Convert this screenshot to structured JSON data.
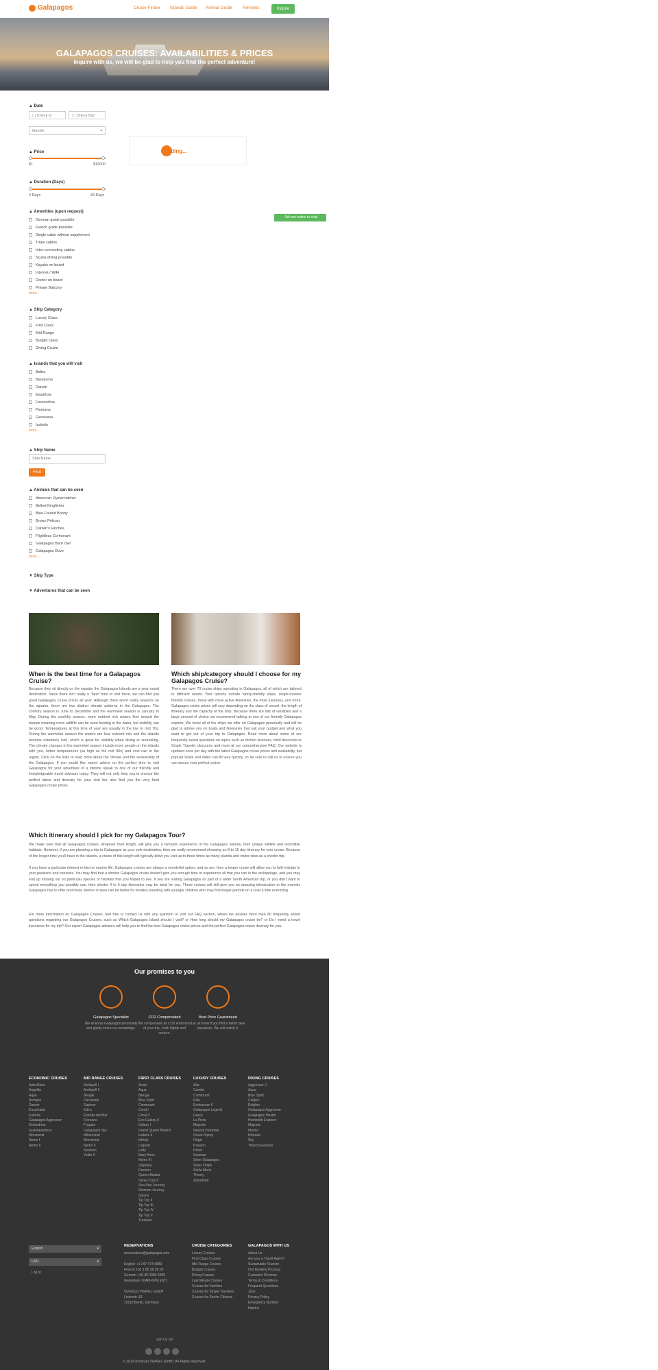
{
  "nav": {
    "logo": "Galapagos",
    "links": [
      "Cruise Finder",
      "Islands Guide",
      "Animal Guide",
      "Reviews"
    ],
    "button": "Inquire"
  },
  "hero": {
    "title": "GALAPAGOS CRUISES: AVAILABILITIES & PRICES",
    "subtitle": "Inquire with us, we will be glad to help you find the perfect adventure!"
  },
  "filters": {
    "date": {
      "title": "Date",
      "checkin": "Check In",
      "checkout": "Check Out",
      "guests": "Guests"
    },
    "price": {
      "title": "Price",
      "min": "$1",
      "max": "$15000"
    },
    "duration": {
      "title": "Duration (Days)",
      "min": "2 Days",
      "max": "30 Days"
    },
    "amenities": {
      "title": "Amenities (upon request)",
      "items": [
        "German guide possible",
        "French guide possible",
        "Single cabin without supplement",
        "Triple cabins",
        "Inter-connecting cabins",
        "Scuba diving possible",
        "Kayaks on board",
        "Internet / WiFi",
        "Doctor on board",
        "Private Balcony"
      ],
      "more": "more..."
    },
    "category": {
      "title": "Ship Category",
      "items": [
        "Luxury Class",
        "First Class",
        "Mid-Range",
        "Budget Class",
        "Diving Cruise"
      ]
    },
    "islands": {
      "title": "Islands that you will visit",
      "items": [
        "Baltra",
        "Bartolome",
        "Darwin",
        "Española",
        "Fernandina",
        "Floreana",
        "Genovesa",
        "Isabela"
      ],
      "more": "more..."
    },
    "ship": {
      "title": "Ship Name",
      "placeholder": "Ship Name",
      "button": "Find"
    },
    "animals": {
      "title": "Animals that can be seen",
      "items": [
        "American Oystercatcher",
        "Belted Kingfisher",
        "Blue Footed Booby",
        "Brown Pelican",
        "Darwin's Finches",
        "Flightless Cormorant",
        "Galapagos Barn Owl",
        "Galapagos Dove"
      ],
      "more": "more..."
    },
    "shiptype": {
      "title": "Ship Type"
    },
    "adventures": {
      "title": "Adventures that can be seen"
    }
  },
  "loading": "Loading...",
  "chat": "We are online to chat",
  "articles": [
    {
      "title": "When is the best time for a Galapagos Cruise?",
      "text": "Because they sit directly on the equator the Galapagos Islands are a year-round destination. Since there isn't really a \"best\" time to visit there, we can find you good Galapagos cruise prices all year. Although there aren't really seasons on the equator, there are two distinct climate patterns in the Galapagos. The cool/dry season is June to December and the warm/wet season is January to May. During the cool/dry season, more nutrient rich waters flow toward the islands meaning more wildlife can be seen feeding in the water, but visibility can be good. Temperatures at this time of year are usually in the low to mid 70s. During the warm/wet season the waters are less nutrient rich and the islands become extremely lush, which is great for visibility when diving or snorkeling. The climate changes in the warm/wet season include more people on the islands with you, hotter temperatures (as high as the mid 80s) and cool rain in the region. Click on the links to read more about the climate and the seasonality of the Galapagos. If you would like expert advice on the perfect time to visit Galapagos for your adventure of a lifetime speak to one of our friendly and knowledgeable travel advisors today. They will not only help you to choose the perfect dates and itinerary for your visit but also find you the very best Galapagos cruise prices."
    },
    {
      "title": "Which ship/category should I choose for my Galapagos Cruise?",
      "text": "There are over 70 cruise ships operating in Galapagos, all of which are tailored to different needs. Your options include family-friendly ships, single-traveler friendly cruises, those with more active itineraries, the most luxurious, and more. Galapagos cruise prices will vary depending on the class of vessel, the length of itinerary and the capacity of the ship. Because there are lots of variables and a large amount of choice we recommend talking to one of our friendly Galapagos experts. We know all of the ships we offer on Galapagos personally and will be glad to advise you on boats and itineraries that suit your budget and what you want to get out of your trip to Galapagos. Read more about some of our frequently asked questions on topics such as motion sickness, child discounts or Single Traveler discounts and more at our comprehensive FAQ. Our website is updated once per day with the latest Galapagos cruise prices and availability, but popular boats and dates can fill very quickly, so be sure to call us to ensure you can secure your perfect cruise."
    }
  ],
  "itinerary": {
    "title": "Which itinerary should I pick for my Galapagos Tour?",
    "p1": "We make sure that all Galapagos cruises, whatever their length, will give you a fantastic experience of the Galapagos Islands, their unique wildlife and incredible habitats. However, if you are planning a trip to Galapagos as your sole destination, then we really recommend choosing an 8 to 15 day itinerary for your cruise. Because of the longer time you'll have in the islands, a cruise of this length will typically allow you visit up to three times as many islands and visitor sites as a shorter trip.",
    "p2": "If you have a particular interest in bird or marine life, Galapagos cruises are always a wonderful option, and so are, then a longer cruise will allow you to fully indulge in your passions and interests. You may find that a shorter Galapagos cruise doesn't give you enough time to experience all that you can in the archipelago, and you may end up missing out on particular species or habitats that you hoped to see. If you are visiting Galapagos as part of a wider South American trip, or you don't want to spend everything you possibly can, then shorter 4 to 6 day itineraries may be ideal for you. These cruises will still give you an amazing introduction to the marvels Galapagos has to offer and these shorter cruises can be better for families traveling with younger children who may find longer periods on a boat a little restricting.",
    "p3": "For more information on Galapagos Cruises, feel free to contact us with any question or visit our FAQ section, where we answer more than 80 frequently asked questions regarding our Galapagos Cruises, such as Which Galapagos Island should I visit? or How long should my Galapagos cruise be? or Do I need a travel insurance for my trip? Our expert Galapagos advisors will help you to find the best Galapagos cruise prices and the perfect Galapagos cruise itinerary for you."
  },
  "promises": {
    "title": "Our promises to you",
    "items": [
      {
        "t": "Galapagos Specialist",
        "d": "We all know Galapagos personally and gladly share our knowledge."
      },
      {
        "t": "CO2 Compensated",
        "d": "We compensate all CO2 emissions of your trip - both flights and cruises."
      },
      {
        "t": "Best Price Guaranteed",
        "d": "Let us know if you find a better deal anywhere. We will match it."
      }
    ]
  },
  "columns": [
    {
      "h": "ECONOMIC CRUISES",
      "items": [
        "Aida Maria",
        "Angelito",
        "Aqua",
        "Archipel",
        "Darwin",
        "Encantada",
        "Estrella",
        "Galapagos Aggressor",
        "Golondrina",
        "Guantanamera",
        "Monserrat",
        "Nemo I",
        "Nemo II"
      ]
    },
    {
      "h": "MID RANGE CRUISES",
      "items": [
        "Archipell I",
        "Archipell II",
        "Beagle",
        "Cachalote",
        "Daphne",
        "Eden",
        "Estrella del Mar",
        "Floreana",
        "Fragata",
        "Galapagos Sky",
        "Millennium",
        "Monserrat",
        "Nemo II",
        "Seaman",
        "Yolita II"
      ]
    },
    {
      "h": "FIRST CLASS CRUISES",
      "items": [
        "Anahi",
        "Aqua",
        "Beluga",
        "Blue Spirit",
        "Cormorant",
        "Coral I",
        "Coral II",
        "Eco Galaxy II",
        "Galaxy I",
        "Grand Queen Beatriz",
        "Isabela II",
        "Infinity",
        "Legend",
        "Letty",
        "Mary Anne",
        "Nemo III",
        "Odyssey",
        "Passion",
        "Queen Beatriz",
        "Santa Cruz II",
        "Sea Star Journey",
        "Seaman Journey",
        "Solaris",
        "Tip Top II",
        "Tip Top III",
        "Tip Top IV",
        "Tip Top V",
        "Treasure"
      ]
    },
    {
      "h": "LUXURY CRUISES",
      "items": [
        "Alia",
        "Camila",
        "Cormorant",
        "Elite",
        "Endeavour II",
        "Galapagos Legend",
        "Grace",
        "La Pinta",
        "Majestic",
        "Natural Paradise",
        "Ocean Spray",
        "Origin",
        "Passion",
        "Petrel",
        "Seaman",
        "Silver Galapagos",
        "Silver Origin",
        "Stella Maris",
        "Theory",
        "Xploration"
      ]
    },
    {
      "h": "DIVING CRUISES",
      "items": [
        "Aggressor II",
        "Aqua",
        "Blue Spirit",
        "Calipso",
        "Dolphin",
        "Galapagos Aggressor",
        "Galapagos Master",
        "Humboldt Explorer",
        "Majestic",
        "Master",
        "Nortada",
        "Sky",
        "Tiburon Explorer"
      ]
    }
  ],
  "footer": {
    "lang": "English",
    "currency": "USD",
    "login": "Log In",
    "reservations": {
      "h": "RESERVATIONS",
      "lines": [
        "reservations@galapagos.com",
        "",
        "English +1 347 474 6883",
        "French +33 1 86 26 26 05",
        "German +49 30 3080 9999",
        "(weekdays 10AM-6PM EST)",
        "",
        "Viventura TRAVEL GmbH",
        "Linienstr. 81",
        "10119 Berlin, Germany"
      ]
    },
    "categories": {
      "h": "CRUISE CATEGORIES",
      "lines": [
        "Luxury Cruises",
        "First Class Cruises",
        "Mid Range Cruises",
        "Budget Cruises",
        "Diving Cruises",
        "Last Minute Cruises",
        "Cruises for Families",
        "Cruises for Single Travelers",
        "Cruises for Senior Citizens"
      ]
    },
    "about": {
      "h": "GALAPAGOS WITH US",
      "lines": [
        "About Us",
        "Are you a Travel Agent?",
        "Sustainable Tourism",
        "Our Booking Process",
        "Customer Reviews",
        "Terms & Conditions",
        "Frequent Questions",
        "Jobs",
        "Privacy Policy",
        "Emergency Number",
        "Imprint"
      ]
    },
    "join": "Join Us On",
    "copyright": "© 2019 viventura TRAVEL GmbH. All Rights Reserved."
  }
}
